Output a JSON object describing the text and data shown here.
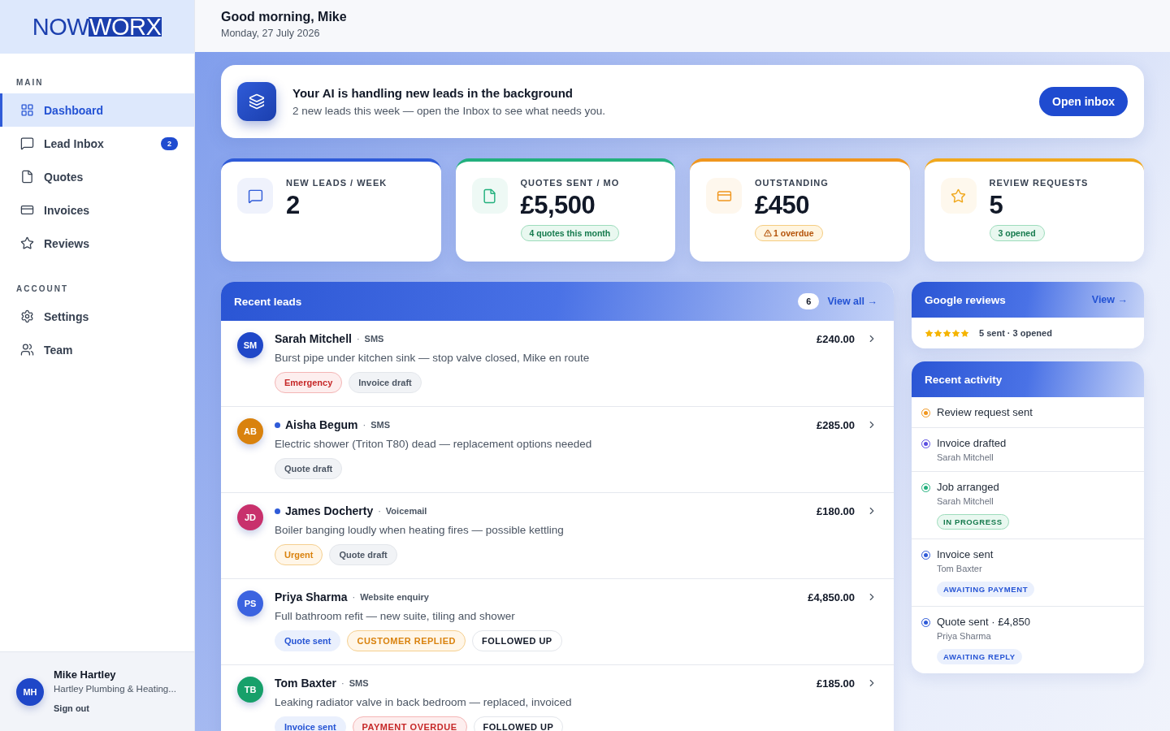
{
  "logo": {
    "part_1": "NOW",
    "part_2": "WORX"
  },
  "sidebar": {
    "sections": [
      {
        "heading": "MAIN",
        "items": [
          {
            "label": "Dashboard",
            "selected": true
          },
          {
            "label": "Lead Inbox",
            "selected": false,
            "badge": "2"
          },
          {
            "label": "Quotes",
            "selected": false
          },
          {
            "label": "Invoices",
            "selected": false
          },
          {
            "label": "Reviews",
            "selected": false
          }
        ]
      },
      {
        "heading": "ACCOUNT",
        "items": [
          {
            "label": "Settings",
            "selected": false
          },
          {
            "label": "Team",
            "selected": false
          }
        ]
      }
    ],
    "user": {
      "initials": "MH",
      "name": "Mike Hartley",
      "company": "Hartley Plumbing & Heating...",
      "sign_out": "Sign out"
    }
  },
  "header": {
    "greeting": "Good morning, Mike",
    "date": "Monday, 27 July 2026"
  },
  "banner": {
    "title": "Your AI is handling new leads in the background",
    "text": "2 new leads this week — open the Inbox to see what needs you.",
    "button": "Open inbox"
  },
  "stats": [
    {
      "label": "NEW LEADS / WEEK",
      "value": "2",
      "color": "#2f5bd8"
    },
    {
      "label": "QUOTES SENT / MO",
      "value": "£5,500",
      "color": "#22b07d",
      "badge": {
        "kind": "success",
        "text": "4 quotes this month"
      }
    },
    {
      "label": "OUTSTANDING",
      "value": "£450",
      "color": "#f0961e",
      "badge": {
        "kind": "warning",
        "text": "1 overdue"
      }
    },
    {
      "label": "REVIEW REQUESTS",
      "value": "5",
      "color": "#f0a81e",
      "badge": {
        "kind": "success",
        "text": "3 opened"
      }
    }
  ],
  "recent_leads": {
    "title": "Recent leads",
    "count": "6",
    "view_all": "View all →",
    "rows": [
      {
        "initials": "SM",
        "color": "#1f47c8",
        "unread": false,
        "name": "Sarah Mitchell",
        "separator": "·",
        "channel": "SMS",
        "amount": "£240.00",
        "summary": "Burst pipe under kitchen sink — stop valve closed, Mike en route",
        "tags": [
          {
            "text": "Emergency",
            "kind": "red"
          },
          {
            "text": "Invoice draft",
            "kind": "gray"
          }
        ]
      },
      {
        "initials": "AB",
        "color": "#d9820e",
        "unread": true,
        "name": "Aisha Begum",
        "separator": "·",
        "channel": "SMS",
        "amount": "£285.00",
        "summary": "Electric shower (Triton T80) dead — replacement options needed",
        "tags": [
          {
            "text": "Quote draft",
            "kind": "gray"
          }
        ]
      },
      {
        "initials": "JD",
        "color": "#c8306c",
        "unread": true,
        "name": "James Docherty",
        "separator": "·",
        "channel": "Voicemail",
        "amount": "£180.00",
        "summary": "Boiler banging loudly when heating fires — possible kettling",
        "tags": [
          {
            "text": "Urgent",
            "kind": "orange"
          },
          {
            "text": "Quote draft",
            "kind": "gray"
          }
        ]
      },
      {
        "initials": "PS",
        "color": "#3b63e0",
        "unread": false,
        "name": "Priya Sharma",
        "separator": "·",
        "channel": "Website enquiry",
        "amount": "£4,850.00",
        "summary": "Full bathroom refit — new suite, tiling and shower",
        "tags": [
          {
            "text": "Quote sent",
            "kind": "blue"
          },
          {
            "text": "CUSTOMER REPLIED",
            "kind": "orange-caps"
          },
          {
            "text": "FOLLOWED UP",
            "kind": "outline"
          }
        ]
      },
      {
        "initials": "TB",
        "color": "#17a06a",
        "unread": false,
        "name": "Tom Baxter",
        "separator": "·",
        "channel": "SMS",
        "amount": "£185.00",
        "summary": "Leaking radiator valve in back bedroom — replaced, invoiced",
        "tags": [
          {
            "text": "Invoice sent",
            "kind": "blue"
          },
          {
            "text": "PAYMENT OVERDUE",
            "kind": "red-caps"
          },
          {
            "text": "FOLLOWED UP",
            "kind": "outline"
          }
        ]
      }
    ]
  },
  "google_reviews": {
    "title": "Google reviews",
    "view": "View →",
    "stars": 5,
    "summary": "**5** sent · **3** opened"
  },
  "recent_activity": {
    "title": "Recent activity",
    "items": [
      {
        "title": "Review request sent",
        "color": "#f0961e"
      },
      {
        "title": "Invoice drafted",
        "subtitle": "Sarah Mitchell",
        "color": "#5b4ee0"
      },
      {
        "title": "Job arranged",
        "subtitle": "Sarah Mitchell",
        "color": "#22b07d",
        "status": {
          "text": "IN PROGRESS",
          "kind": "green"
        }
      },
      {
        "title": "Invoice sent",
        "subtitle": "Tom Baxter",
        "color": "#2f5bd8",
        "status": {
          "text": "AWAITING PAYMENT",
          "kind": "blue"
        }
      },
      {
        "title": "Quote sent · £4,850",
        "subtitle": "Priya Sharma",
        "color": "#2f5bd8",
        "status": {
          "text": "AWAITING REPLY",
          "kind": "blue"
        }
      }
    ]
  }
}
